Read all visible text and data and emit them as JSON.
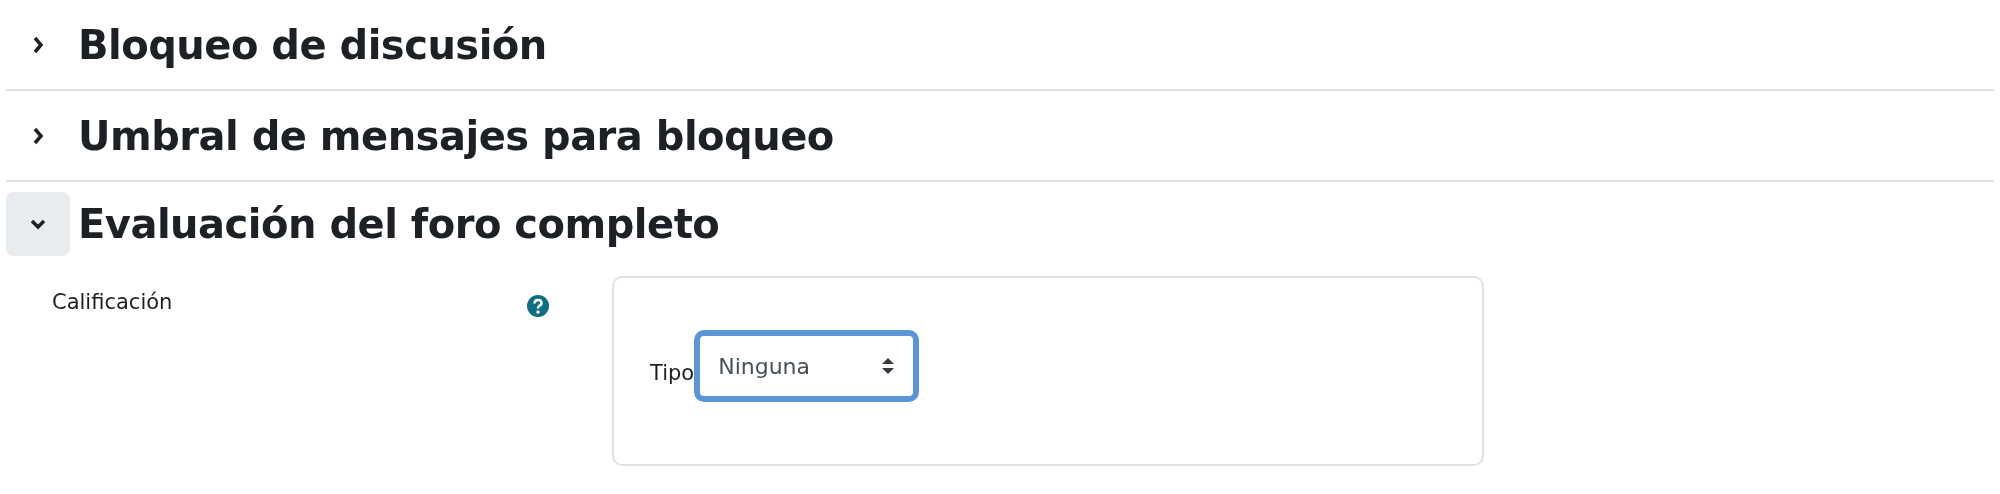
{
  "sections": [
    {
      "title": "Bloqueo de discusión",
      "expanded": false
    },
    {
      "title": "Umbral de mensajes para bloqueo",
      "expanded": false
    },
    {
      "title": "Evaluación del foro completo",
      "expanded": true,
      "fields": [
        {
          "label": "Calificación",
          "group": {
            "label": "Tipo",
            "select": {
              "value": "Ninguna",
              "focused": true
            }
          }
        }
      ]
    }
  ]
}
